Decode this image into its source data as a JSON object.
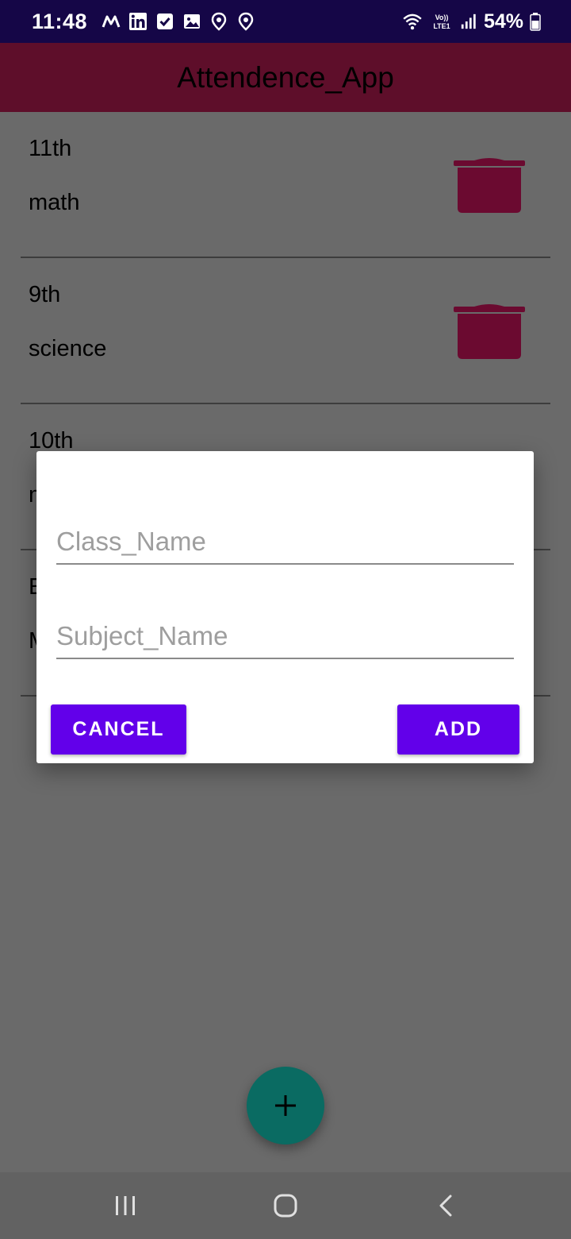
{
  "status_bar": {
    "time": "11:48",
    "battery": "54%",
    "left_icons": [
      "m-app-icon",
      "linkedin-icon",
      "checkbox-icon",
      "gallery-icon",
      "location-pin-icon",
      "location-pin-icon"
    ],
    "right_icons": [
      "wifi-icon",
      "volte-lte-icon",
      "signal-icon",
      "battery-icon"
    ]
  },
  "app_bar": {
    "title": "Attendence_App"
  },
  "list": {
    "items": [
      {
        "class_name": "11th",
        "subject_name": "math"
      },
      {
        "class_name": "9th",
        "subject_name": "science"
      },
      {
        "class_name": "10th",
        "subject_name": "m"
      },
      {
        "class_name": "E",
        "subject_name": "M"
      }
    ]
  },
  "dialog": {
    "class_placeholder": "Class_Name",
    "subject_placeholder": "Subject_Name",
    "cancel_label": "CANCEL",
    "add_label": "ADD"
  },
  "fab": {
    "icon": "plus-icon"
  },
  "nav_bar": {
    "icons": [
      "recents-icon",
      "home-icon",
      "back-icon"
    ]
  },
  "colors": {
    "status_bar": "#150647",
    "app_bar": "#5e0e2a",
    "delete_icon": "#6b0a30",
    "dialog_button": "#6200ea",
    "fab": "#0a6b62",
    "scrim_background": "#6a6a6a"
  }
}
